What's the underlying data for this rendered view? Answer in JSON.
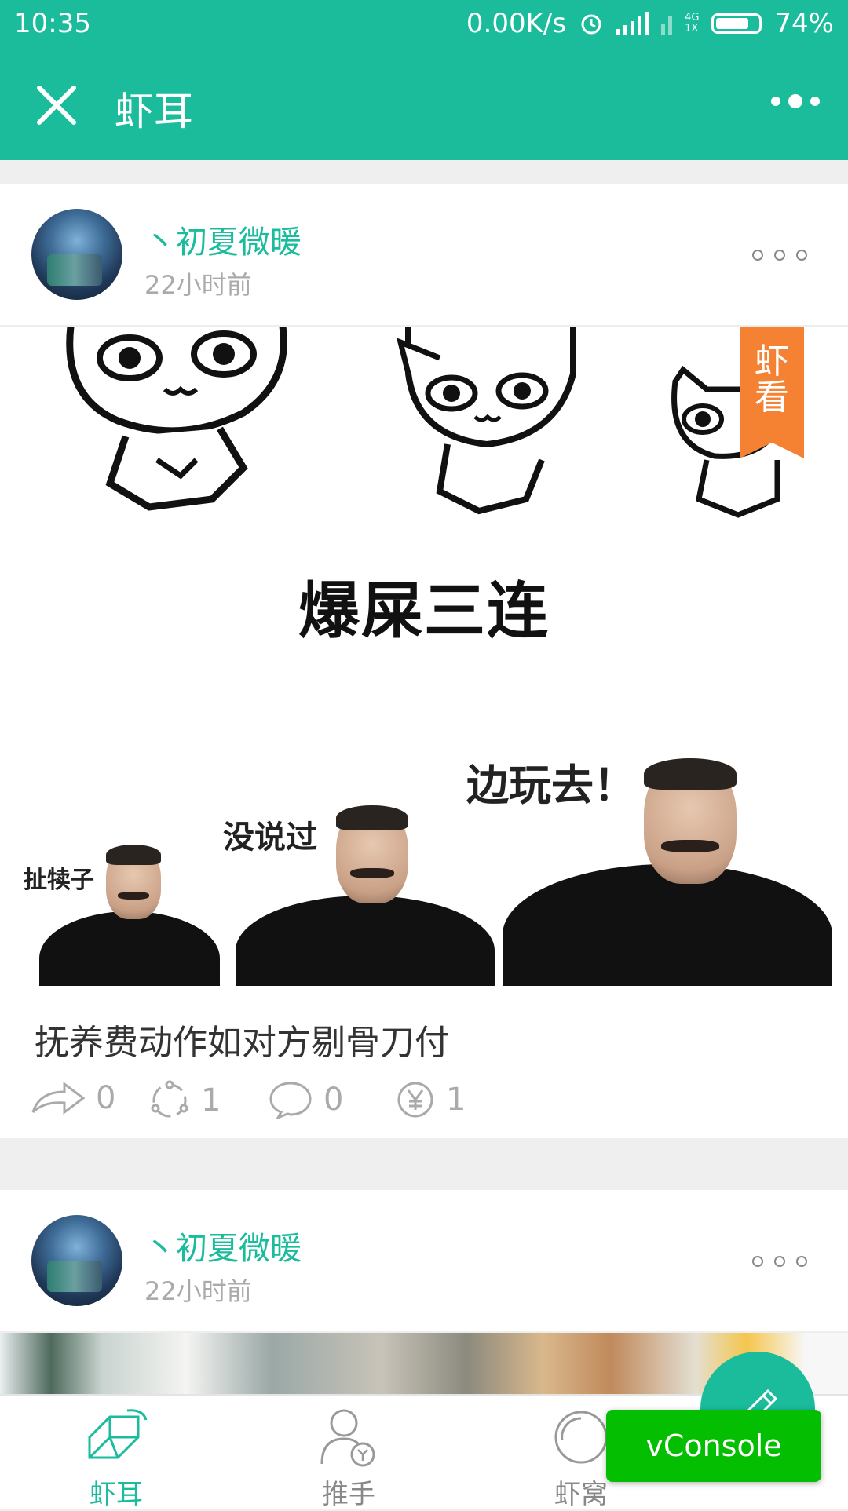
{
  "status_bar": {
    "time": "10:35",
    "network_speed": "0.00K/s",
    "network_type": "4G",
    "sim_slot": "1X",
    "battery": "74%"
  },
  "app_bar": {
    "title": "虾耳",
    "close_icon": "close-icon",
    "more_icon": "more-icon"
  },
  "posts": [
    {
      "username": "丶初夏微暖",
      "time_ago": "22小时前",
      "ribbon": "虾看",
      "meme_caption": "爆屎三连",
      "speech": [
        "扯犊子",
        "没说过",
        "边玩去！"
      ],
      "title": "抚养费动作如对方剔骨刀付",
      "actions": {
        "share": "0",
        "bounce": "1",
        "comment": "0",
        "reward": "1"
      }
    },
    {
      "username": "丶初夏微暖",
      "time_ago": "22小时前"
    }
  ],
  "bottom_nav": [
    {
      "label": "虾耳",
      "icon": "shrimp-icon",
      "active": true
    },
    {
      "label": "推手",
      "icon": "user-coin-icon",
      "active": false
    },
    {
      "label": "虾窝",
      "icon": "circle-icon",
      "active": false
    }
  ],
  "fab": {
    "icon": "pencil-icon"
  },
  "vconsole": {
    "label": "vConsole"
  },
  "colors": {
    "brand": "#1abc9c",
    "ribbon": "#f58233",
    "vconsole": "#04be02"
  }
}
